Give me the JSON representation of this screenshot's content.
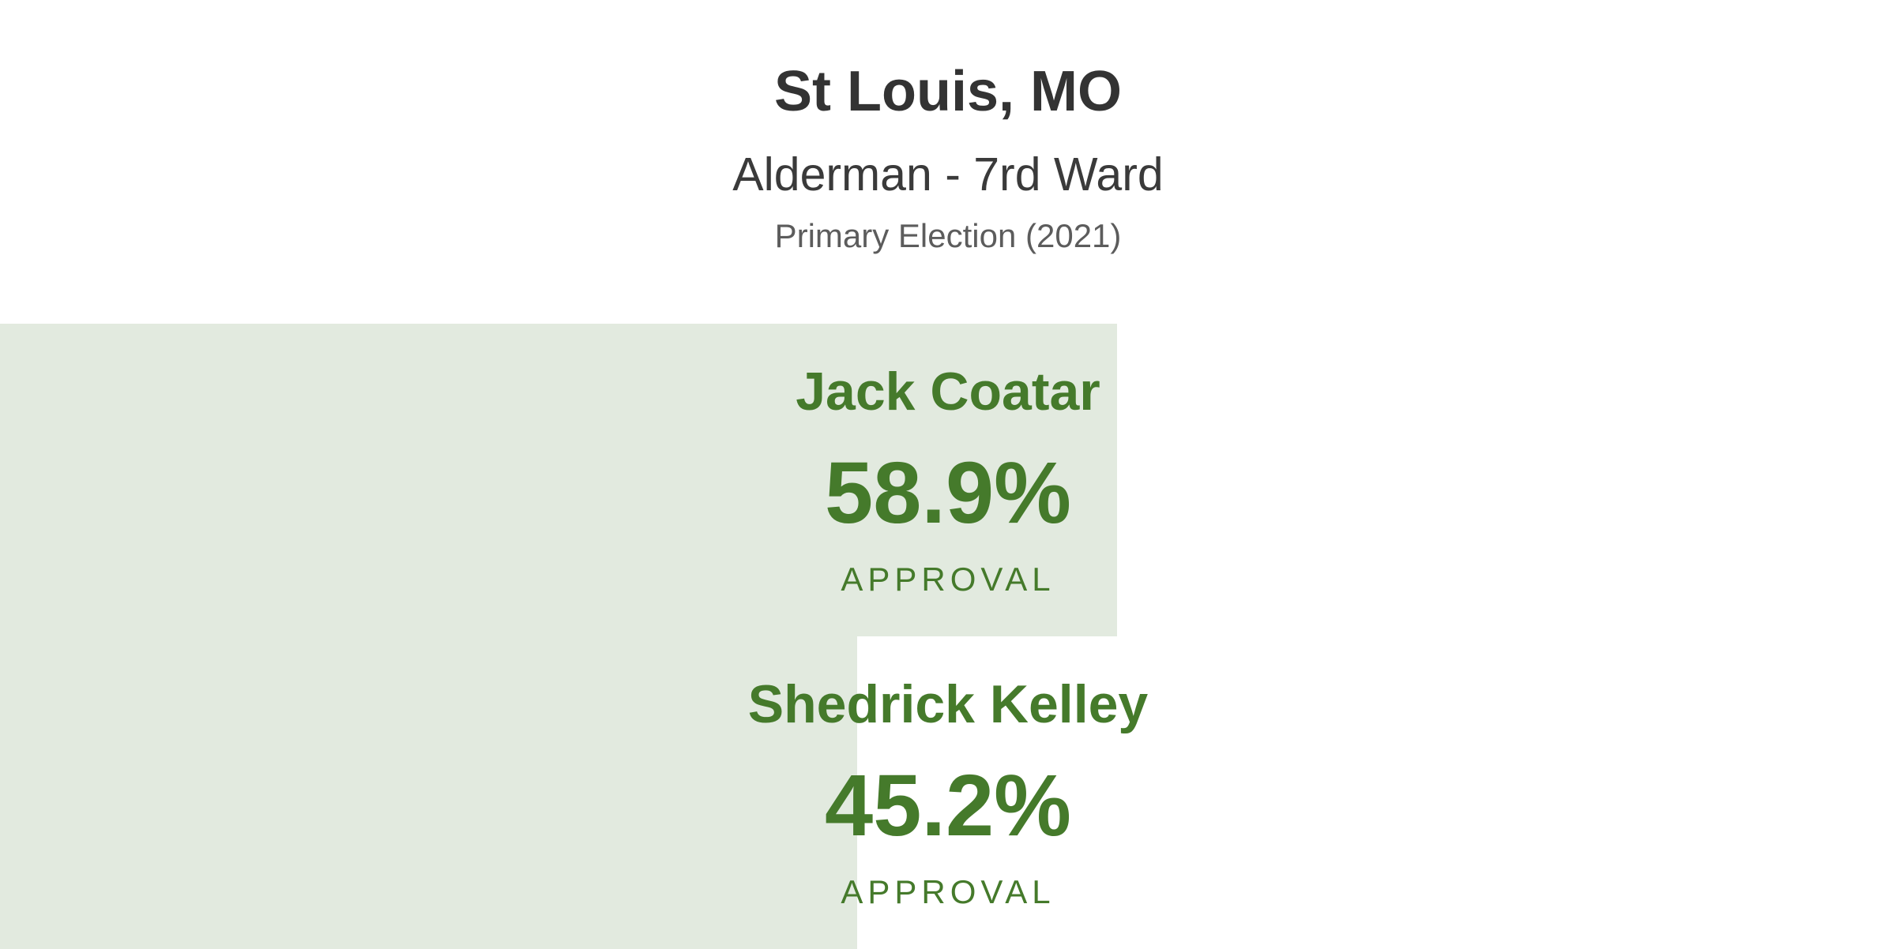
{
  "header": {
    "city": "St Louis, MO",
    "race": "Alderman - 7rd Ward",
    "election": "Primary Election (2021)"
  },
  "colors": {
    "bar": "#e2eadf",
    "accent": "#457a2b",
    "title": "#333333"
  },
  "chart_data": {
    "type": "bar",
    "orientation": "horizontal",
    "title": "St Louis, MO",
    "subtitle": "Alderman - 7rd Ward",
    "caption": "Primary Election (2021)",
    "categories": [
      "Jack Coatar",
      "Shedrick Kelley"
    ],
    "values": [
      58.9,
      45.2
    ],
    "value_labels": [
      "58.9%",
      "45.2%"
    ],
    "metric_label": "APPROVAL",
    "unit": "%",
    "xlim": [
      0,
      100
    ],
    "grid": false,
    "legend": "none"
  }
}
